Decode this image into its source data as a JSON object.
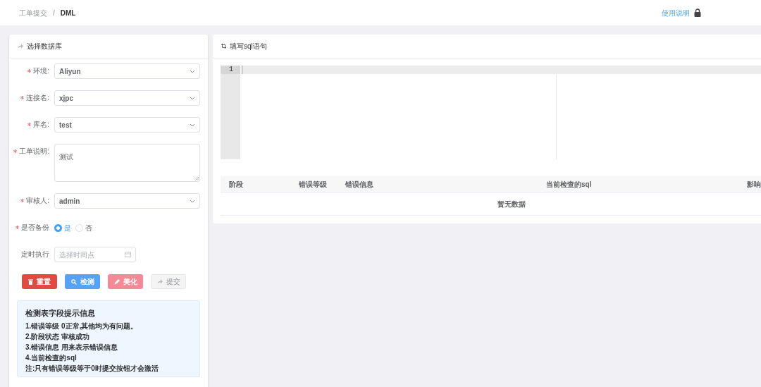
{
  "breadcrumb": [
    {
      "label": "工单提交",
      "current": false
    },
    {
      "label": "/",
      "current": false
    },
    {
      "label": "DML",
      "current": true
    }
  ],
  "help_link": "使用说明",
  "left_panel": {
    "title": "选择数据库",
    "fields": [
      {
        "kind": "select",
        "label": "环境:",
        "required": true,
        "value": "Aliyun"
      },
      {
        "kind": "select",
        "label": "连接名:",
        "required": true,
        "value": "xjpc"
      },
      {
        "kind": "select",
        "label": "库名:",
        "required": true,
        "value": "test"
      },
      {
        "kind": "textarea",
        "label": "工单说明:",
        "required": true,
        "value": "测试"
      },
      {
        "kind": "select",
        "label": "审核人:",
        "required": true,
        "value": "admin"
      },
      {
        "kind": "radio",
        "label": "是否备份",
        "required": true,
        "options": [
          {
            "label": "是",
            "selected": true
          },
          {
            "label": "否",
            "selected": false
          }
        ]
      },
      {
        "kind": "date",
        "label": "定时执行",
        "required": false,
        "placeholder": "选择时间点"
      }
    ],
    "buttons": [
      {
        "label": "重置",
        "kind": "delete",
        "color": "#e04a42",
        "disabled": false
      },
      {
        "label": "检测",
        "kind": "search",
        "color": "#55a2f7",
        "disabled": false
      },
      {
        "label": "美化",
        "kind": "pen",
        "color": "#f48a96",
        "disabled": false
      },
      {
        "label": "提交",
        "kind": "share",
        "color": "#f4f4f5",
        "disabled": true
      }
    ],
    "info": {
      "title": "检测表字段提示信息",
      "lines": [
        "1.错误等级 0正常,其他均为有问题。",
        "2.阶段状态 审核成功",
        "3.错误信息 用来表示错误信息",
        "4.当前检查的sql",
        "注:只有错误等级等于0时提交按钮才会激活"
      ]
    }
  },
  "right_panel": {
    "title": "填写sql语句",
    "editor": {
      "line_numbers": [
        "1"
      ]
    },
    "table": {
      "columns": [
        "阶段",
        "错误等级",
        "错误信息",
        "当前检查的sql",
        "影响"
      ],
      "empty_text": "暂无数据"
    }
  }
}
